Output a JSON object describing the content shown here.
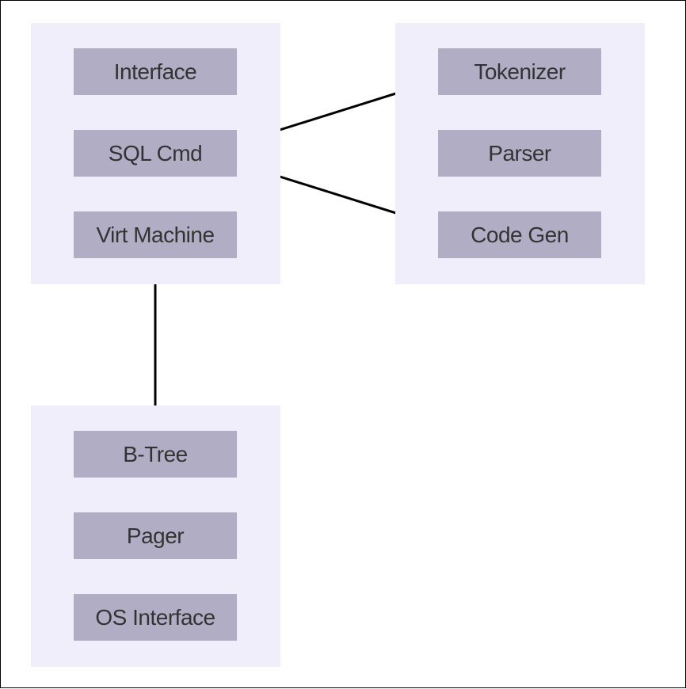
{
  "diagram": {
    "groups": {
      "top_left": [
        "Interface",
        "SQL Cmd",
        "Virt Machine"
      ],
      "top_right": [
        "Tokenizer",
        "Parser",
        "Code Gen"
      ],
      "bottom_left": [
        "B-Tree",
        "Pager",
        "OS Interface"
      ]
    },
    "nodes": {
      "interface": "Interface",
      "sql_cmd": "SQL Cmd",
      "virt_machine": "Virt Machine",
      "tokenizer": "Tokenizer",
      "parser": "Parser",
      "code_gen": "Code Gen",
      "b_tree": "B-Tree",
      "pager": "Pager",
      "os_interface": "OS Interface"
    },
    "edges": [
      [
        "interface",
        "sql_cmd"
      ],
      [
        "sql_cmd",
        "virt_machine"
      ],
      [
        "virt_machine",
        "b_tree"
      ],
      [
        "b_tree",
        "pager"
      ],
      [
        "pager",
        "os_interface"
      ],
      [
        "sql_cmd",
        "tokenizer"
      ],
      [
        "sql_cmd",
        "code_gen"
      ],
      [
        "tokenizer",
        "parser"
      ],
      [
        "parser",
        "code_gen"
      ]
    ],
    "colors": {
      "group_bg": "#f0eefa",
      "node_bg": "#b1adc4",
      "line": "#000000",
      "border": "#000000"
    }
  }
}
